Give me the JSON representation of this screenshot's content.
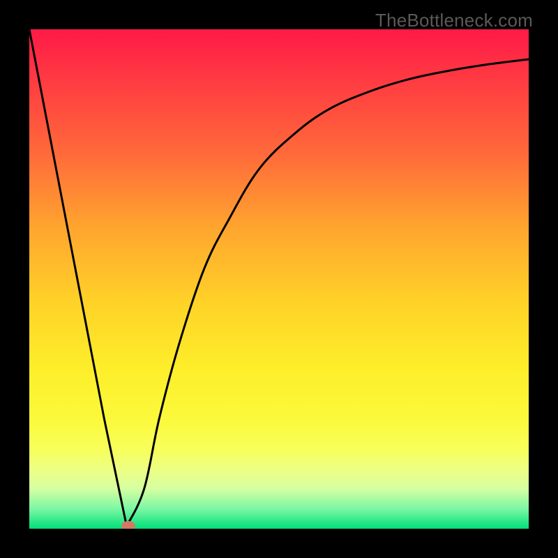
{
  "attribution": "TheBottleneck.com",
  "chart_data": {
    "type": "line",
    "title": "",
    "xlabel": "",
    "ylabel": "",
    "xlim": [
      0,
      100
    ],
    "ylim": [
      0,
      100
    ],
    "grid": false,
    "series": [
      {
        "name": "bottleneck-curve",
        "x": [
          0,
          5,
          10,
          15,
          19.5,
          23,
          26,
          30,
          35,
          40,
          46,
          53,
          60,
          68,
          76,
          84,
          92,
          100
        ],
        "y": [
          100,
          74,
          48,
          22,
          0.5,
          8,
          22,
          37,
          52,
          62,
          72,
          79,
          84,
          87.5,
          90,
          91.7,
          93,
          94
        ]
      }
    ],
    "marker": {
      "x": 19.8,
      "y": 0.5,
      "color": "#d17a63"
    },
    "background_gradient_top": "#ff1a47",
    "background_gradient_bottom": "#00e07a"
  }
}
